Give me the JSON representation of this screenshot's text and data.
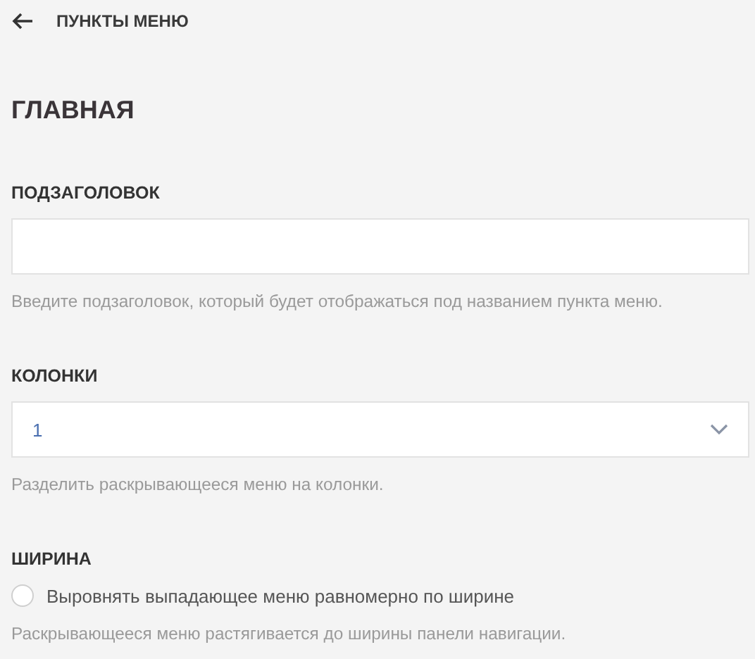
{
  "header": {
    "back_label": "ПУНКТЫ МЕНЮ"
  },
  "title": "ГЛАВНАЯ",
  "fields": [
    {
      "kind": "text",
      "label": "ПОДЗАГОЛОВОК",
      "hint": "Введите подзаголовок, который будет отображаться под названием пункта меню."
    },
    {
      "kind": "select",
      "label": "КОЛОНКИ",
      "value": "1",
      "hint": "Разделить раскрывающееся меню на колонки."
    },
    {
      "kind": "radio",
      "label": "ШИРИНА",
      "option": "Выровнять выпадающее меню равномерно по ширине",
      "checked": false,
      "hint": "Раскрывающееся меню растягивается до ширины панели навигации."
    }
  ]
}
